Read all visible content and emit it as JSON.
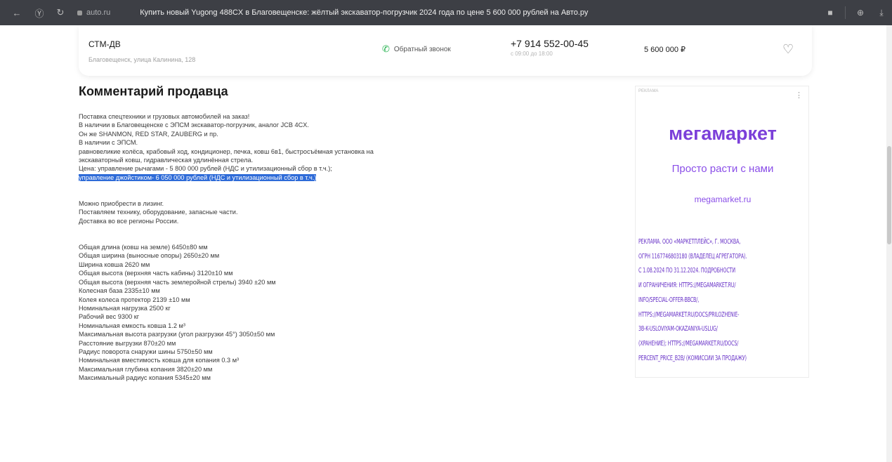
{
  "browser": {
    "domain": "auto.ru",
    "tab_title": "Купить новый Yugong 488CX в Благовещенске: жёлтый экскаватор-погрузчик 2024 года по цене 5 600 000 рублей на Авто.ру",
    "icons": [
      "back-icon",
      "yandex-icon",
      "reload-icon",
      "lock-icon",
      "bookmark-icon",
      "extensions-icon",
      "download-icon"
    ]
  },
  "seller": {
    "name": "СТМ-ДВ",
    "address": "Благовещенск, улица Калинина, 128",
    "callback_label": "Обратный звонок",
    "phone": "+7 914 552-00-45",
    "phone_hours": "с 09:00 до 18:00",
    "price": "5 600 000 ₽"
  },
  "comment": {
    "heading": "Комментарий продавца",
    "lines": [
      "Поставка спецтехники и грузовых автомобилей на заказ!",
      "В наличии в Благовещенске с ЭПСМ экскаватор-погрузчик, аналог JCB 4CX.",
      "Он же SHANMON, RED STAR, ZAUBERG и пр.",
      "В наличии с ЭПСМ.",
      "равновеликие колёса, крабовый ход, кондиционер, печка, ковш 6в1, быстросъёмная установка на",
      "экскаваторный ковш, гидравлическая удлинённая стрела.",
      "Цена: управление рычагами - 5 800 000 рублей (НДС и утилизационный сбор в т.ч.);"
    ],
    "highlighted_line": "управление джойстиком- 6 050 000 рублей (НДС и утилизационный сбор в т.ч.)",
    "lines_2": [
      "Можно приобрести в лизинг.",
      "Поставляем технику, оборудование, запасные части.",
      "Доставка во все регионы России."
    ],
    "specs": [
      "Общая длина (ковш на земле) 6450±80 мм",
      "Общая ширина (выносные опоры) 2650±20 мм",
      "Ширина ковша 2620 мм",
      "Общая высота (верхняя часть кабины) 3120±10 мм",
      "Общая высота (верхняя часть землеройной стрелы) 3940 ±20 мм",
      "Колесная база 2335±10 мм",
      "Колея колеса протектор 2139 ±10 мм",
      "Номинальная нагрузка 2500 кг",
      "Рабочий вес 9300 кг",
      "Номинальная емкость ковша 1.2 м³",
      "Максимальная высота разгрузки (угол разгрузки 45°) 3050±50 мм",
      "Расстояние выгрузки 870±20 мм",
      "Радиус поворота снаружи шины 5750±50 мм",
      "Номинальная вместимость ковша для копания 0.3 м³",
      "Максимальная глубина копания 3820±20 мм",
      "Максимальный радиус копания 5345±20 мм"
    ]
  },
  "ad": {
    "label": "РЕКЛАМА",
    "brand": "мегамаркет",
    "slogan": "Просто расти с нами",
    "site": "megamarket.ru",
    "legal_lines": [
      "РЕКЛАМА. ООО «МАРКЕТПЛЕЙС», Г. МОСКВА,",
      "ОГРН 1167746803180 (ВЛАДЕЛЕЦ АГРЕГАТОРА).",
      "С 1.08.2024 ПО 31.12.2024. ПОДРОБНОСТИ",
      "И ОГРАНИЧЕНИЯ: HTTPS://MEGAMARKET.RU/",
      "INFO/SPECIAL-OFFER-BBCB/,",
      "HTTPS://MEGAMARKET.RU/DOCS/PRILOZHENIE-",
      "3B-K-USLOVIYAM-OKAZANIYA-USLUG/",
      "(XPAHEHИE); HTTPS://MEGAMARKET.RU/DOCS/",
      "PERCENT_PRICE_B2B/ (КОМИССИИ ЗА ПРОДАЖУ)"
    ]
  },
  "colors": {
    "browser_bar": "#3d3f45",
    "selection": "#2e6bd8",
    "ad_purple": "#7b3fd9",
    "phone_green": "#22b14c"
  }
}
